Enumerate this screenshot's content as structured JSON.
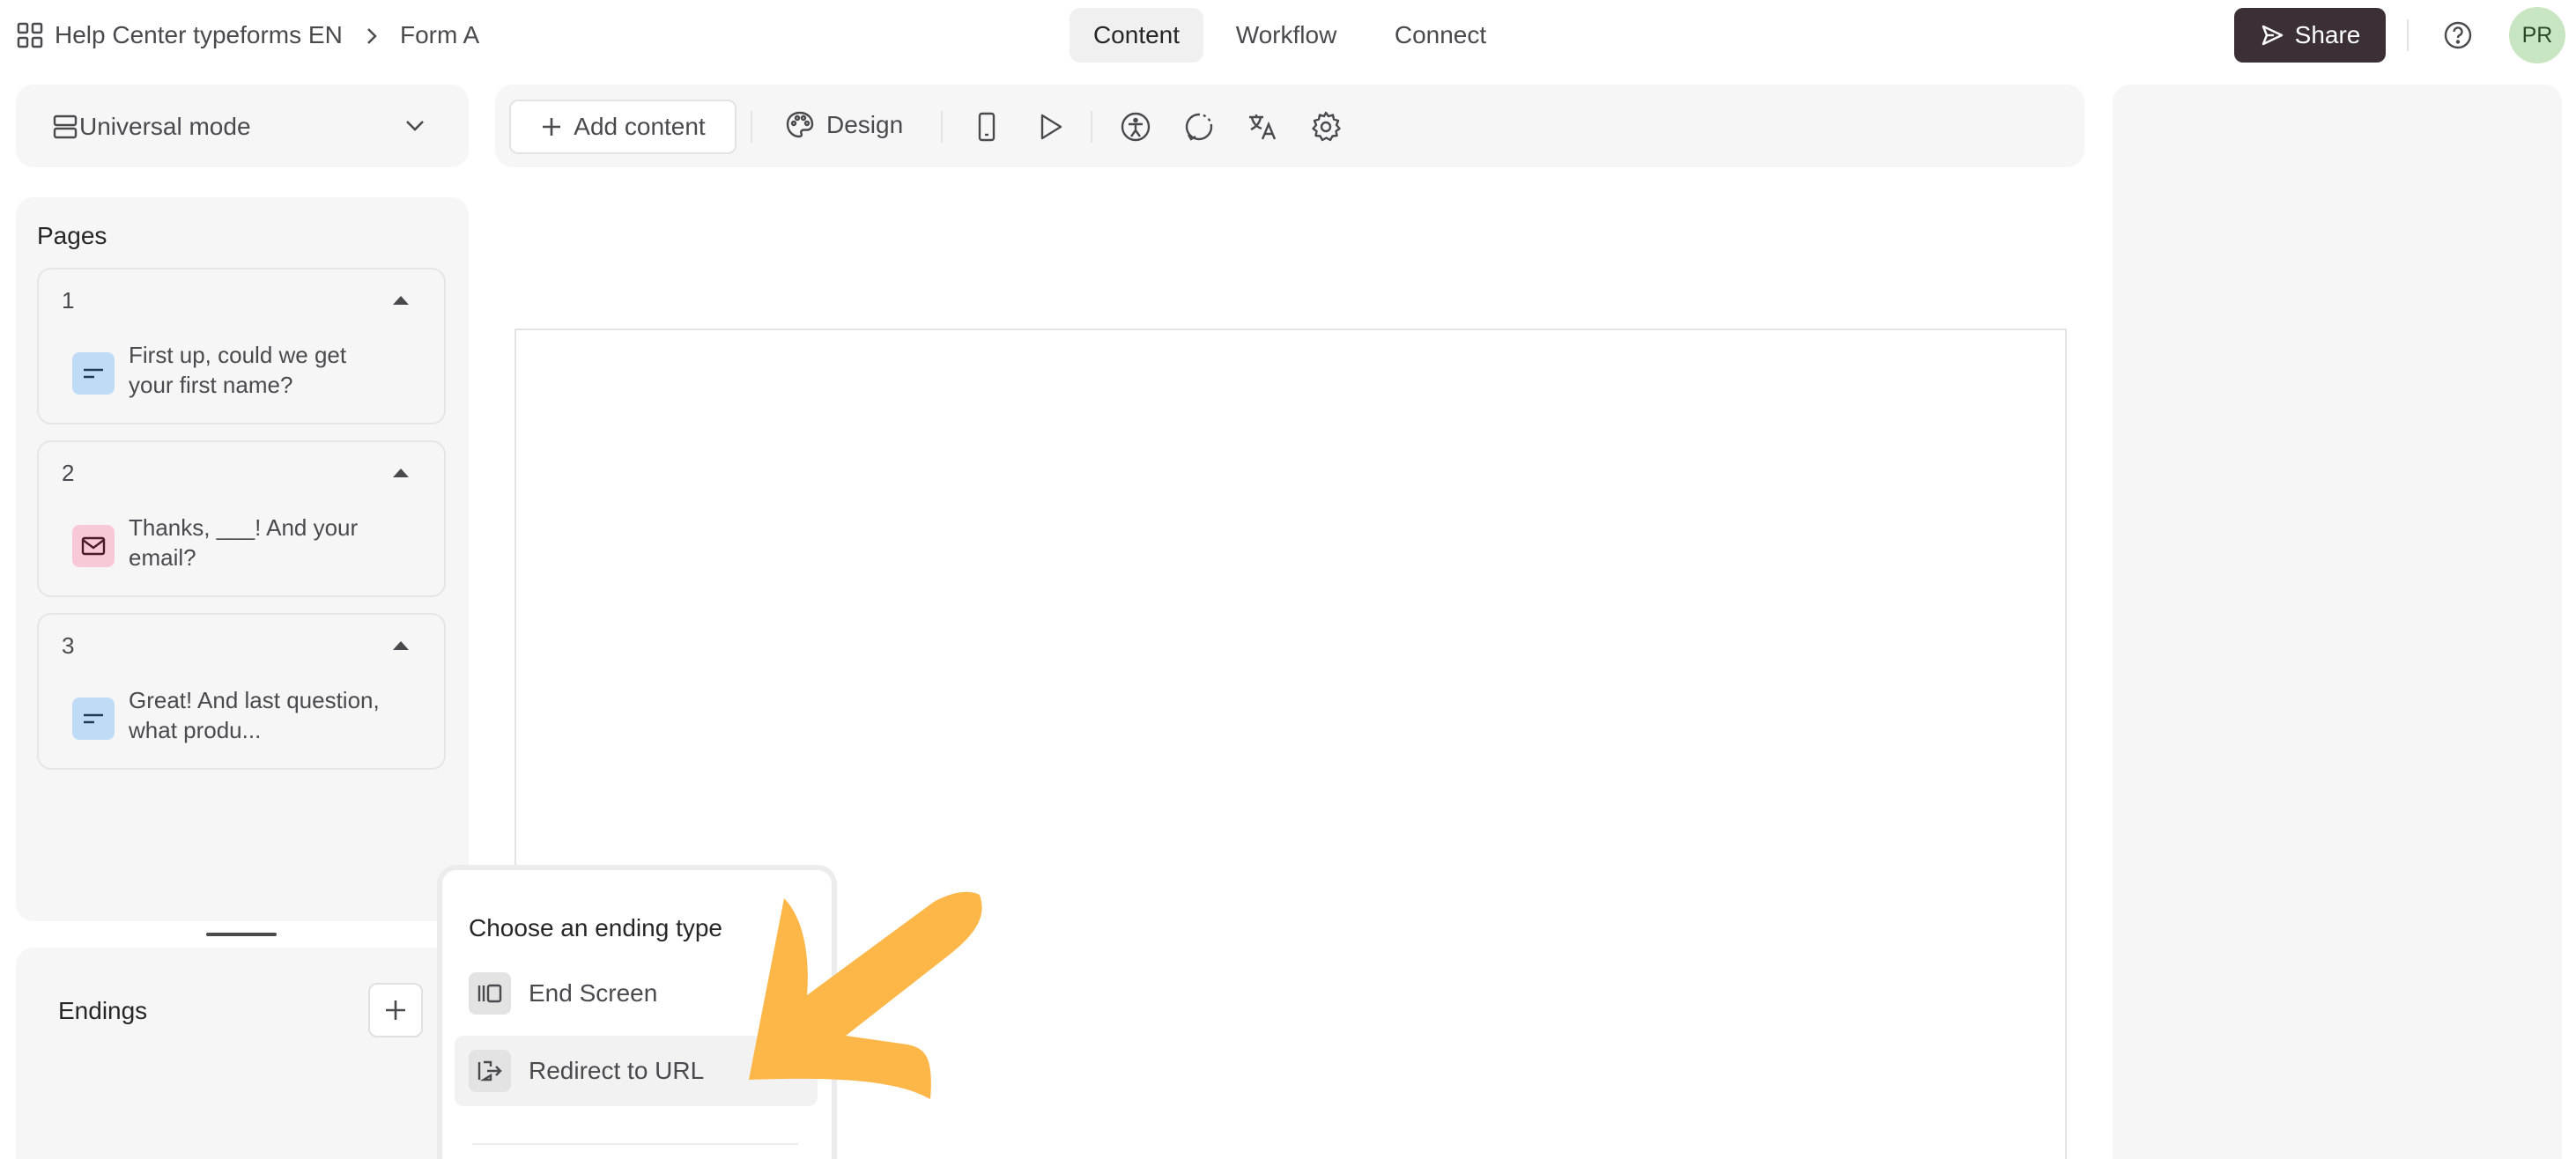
{
  "header": {
    "workspace": "Help Center typeforms EN",
    "form": "Form A",
    "tabs": [
      {
        "label": "Content",
        "active": true
      },
      {
        "label": "Workflow",
        "active": false
      },
      {
        "label": "Connect",
        "active": false
      }
    ],
    "share_label": "Share",
    "avatar_initials": "PR"
  },
  "mode_selector": {
    "label": "Universal mode"
  },
  "toolbar": {
    "add_content_label": "Add content",
    "design_label": "Design"
  },
  "pages": {
    "title": "Pages",
    "items": [
      {
        "number": "1",
        "text": "First up, could we get your first name?",
        "type": "short-text",
        "color": "#bfdcf7"
      },
      {
        "number": "2",
        "text": "Thanks, ___! And your email?",
        "type": "email",
        "color": "#f7c9d6"
      },
      {
        "number": "3",
        "text": "Great! And last question, what produ...",
        "type": "short-text",
        "color": "#bfdcf7"
      }
    ]
  },
  "endings": {
    "title": "Endings"
  },
  "ending_menu": {
    "title": "Choose an ending type",
    "items": [
      {
        "label": "End Screen",
        "icon": "end-screen-icon"
      },
      {
        "label": "Redirect to URL",
        "icon": "redirect-icon"
      }
    ]
  },
  "colors": {
    "accent_arrow": "#fdb748",
    "share_bg": "#3a3036",
    "avatar_bg": "#c8e6c1"
  }
}
